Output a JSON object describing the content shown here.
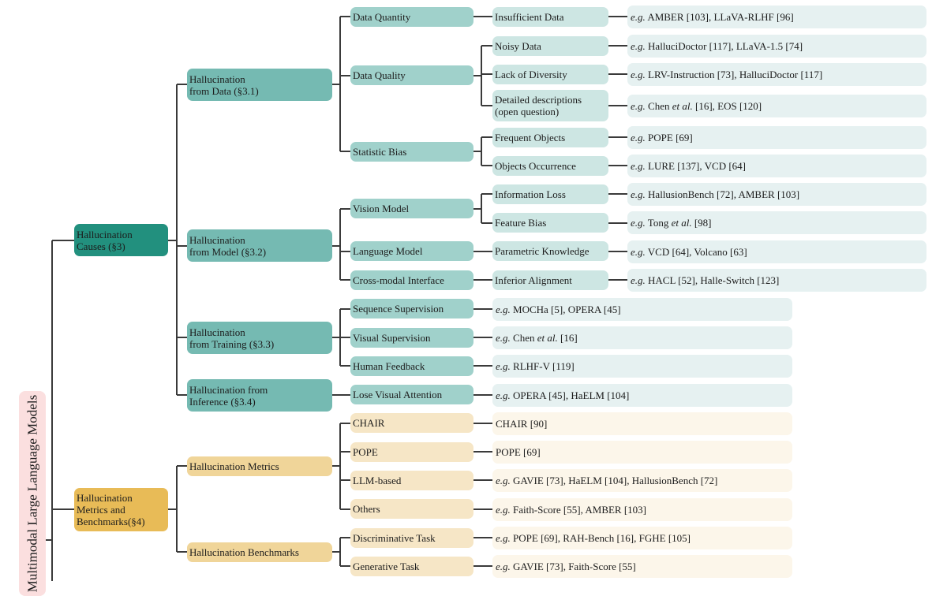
{
  "root": {
    "label": "Multimodal Large Language Models"
  },
  "colors": {
    "line": "#3a3a3a",
    "root_bg": "#fbdfdf",
    "causes_l1": "#22907e",
    "causes_l2": "#75bab2",
    "causes_l3": "#a0d1cb",
    "causes_l4": "#cde6e3",
    "causes_leaf": "#e6f1f1",
    "metrics_l1": "#e8bb57",
    "metrics_l2": "#f0d599",
    "metrics_l3": "#f6e6c6",
    "metrics_leaf": "#fcf6ea"
  },
  "causes": {
    "label": "Hallucination\nCauses (§3)",
    "from_data": {
      "label": "Hallucination\nfrom Data (§3.1)",
      "data_quantity": {
        "label": "Data Quantity",
        "insufficient": {
          "label": "Insufficient Data",
          "eg": "e.g.",
          "refs": " AMBER [103], LLaVA-RLHF [96]"
        }
      },
      "data_quality": {
        "label": "Data Quality",
        "noisy": {
          "label": "Noisy Data",
          "eg": "e.g.",
          "refs": " HalluciDoctor [117], LLaVA-1.5 [74]"
        },
        "diversity": {
          "label": "Lack of Diversity",
          "eg": "e.g.",
          "refs": " LRV-Instruction [73], HalluciDoctor [117]"
        },
        "detailed": {
          "label": "Detailed descriptions\n(open question)",
          "eg": "e.g.",
          "pre": " Chen ",
          "etal": "et al.",
          "refs": " [16], EOS [120]"
        }
      },
      "statistic_bias": {
        "label": "Statistic Bias",
        "frequent": {
          "label": "Frequent Objects",
          "eg": "e.g.",
          "refs": " POPE [69]"
        },
        "occurrence": {
          "label": "Objects Occurrence",
          "eg": "e.g.",
          "refs": " LURE [137], VCD [64]"
        }
      }
    },
    "from_model": {
      "label": "Hallucination\nfrom Model (§3.2)",
      "vision": {
        "label": "Vision Model",
        "info_loss": {
          "label": "Information Loss",
          "eg": "e.g.",
          "refs": " HallusionBench [72], AMBER [103]"
        },
        "feature_bias": {
          "label": "Feature Bias",
          "eg": "e.g.",
          "pre": " Tong ",
          "etal": "et al.",
          "refs": " [98]"
        }
      },
      "language": {
        "label": "Language Model",
        "parametric": {
          "label": "Parametric Knowledge",
          "eg": "e.g.",
          "refs": " VCD [64], Volcano [63]"
        }
      },
      "cross_modal": {
        "label": "Cross-modal Interface",
        "inferior": {
          "label": "Inferior Alignment",
          "eg": "e.g.",
          "refs": " HACL [52], Halle-Switch [123]"
        }
      }
    },
    "from_training": {
      "label": "Hallucination\nfrom Training (§3.3)",
      "sequence": {
        "label": "Sequence Supervision",
        "eg": "e.g.",
        "refs": " MOCHa [5], OPERA [45]"
      },
      "visual": {
        "label": "Visual Supervision",
        "eg": "e.g.",
        "pre": " Chen ",
        "etal": "et al.",
        "refs": " [16]"
      },
      "human": {
        "label": "Human Feedback",
        "eg": "e.g.",
        "refs": " RLHF-V [119]"
      }
    },
    "from_inference": {
      "label": "Hallucination from\nInference (§3.4)",
      "lose_attention": {
        "label": "Lose Visual Attention",
        "eg": "e.g.",
        "refs": " OPERA [45], HaELM [104]"
      }
    }
  },
  "metrics": {
    "label": "Hallucination\nMetrics and\nBenchmarks(§4)",
    "hall_metrics": {
      "label": "Hallucination Metrics",
      "chair": {
        "label": "CHAIR",
        "refs": "CHAIR [90]"
      },
      "pope": {
        "label": "POPE",
        "refs": "POPE [69]"
      },
      "llm": {
        "label": "LLM-based",
        "eg": "e.g.",
        "refs": " GAVIE [73], HaELM [104], HallusionBench [72]"
      },
      "others": {
        "label": "Others",
        "eg": "e.g.",
        "refs": " Faith-Score [55], AMBER [103]"
      }
    },
    "hall_benchmarks": {
      "label": "Hallucination Benchmarks",
      "discriminative": {
        "label": "Discriminative Task",
        "eg": "e.g.",
        "refs": " POPE [69], RAH-Bench [16], FGHE [105]"
      },
      "generative": {
        "label": "Generative Task",
        "eg": "e.g.",
        "refs": " GAVIE [73], Faith-Score [55]"
      }
    }
  }
}
